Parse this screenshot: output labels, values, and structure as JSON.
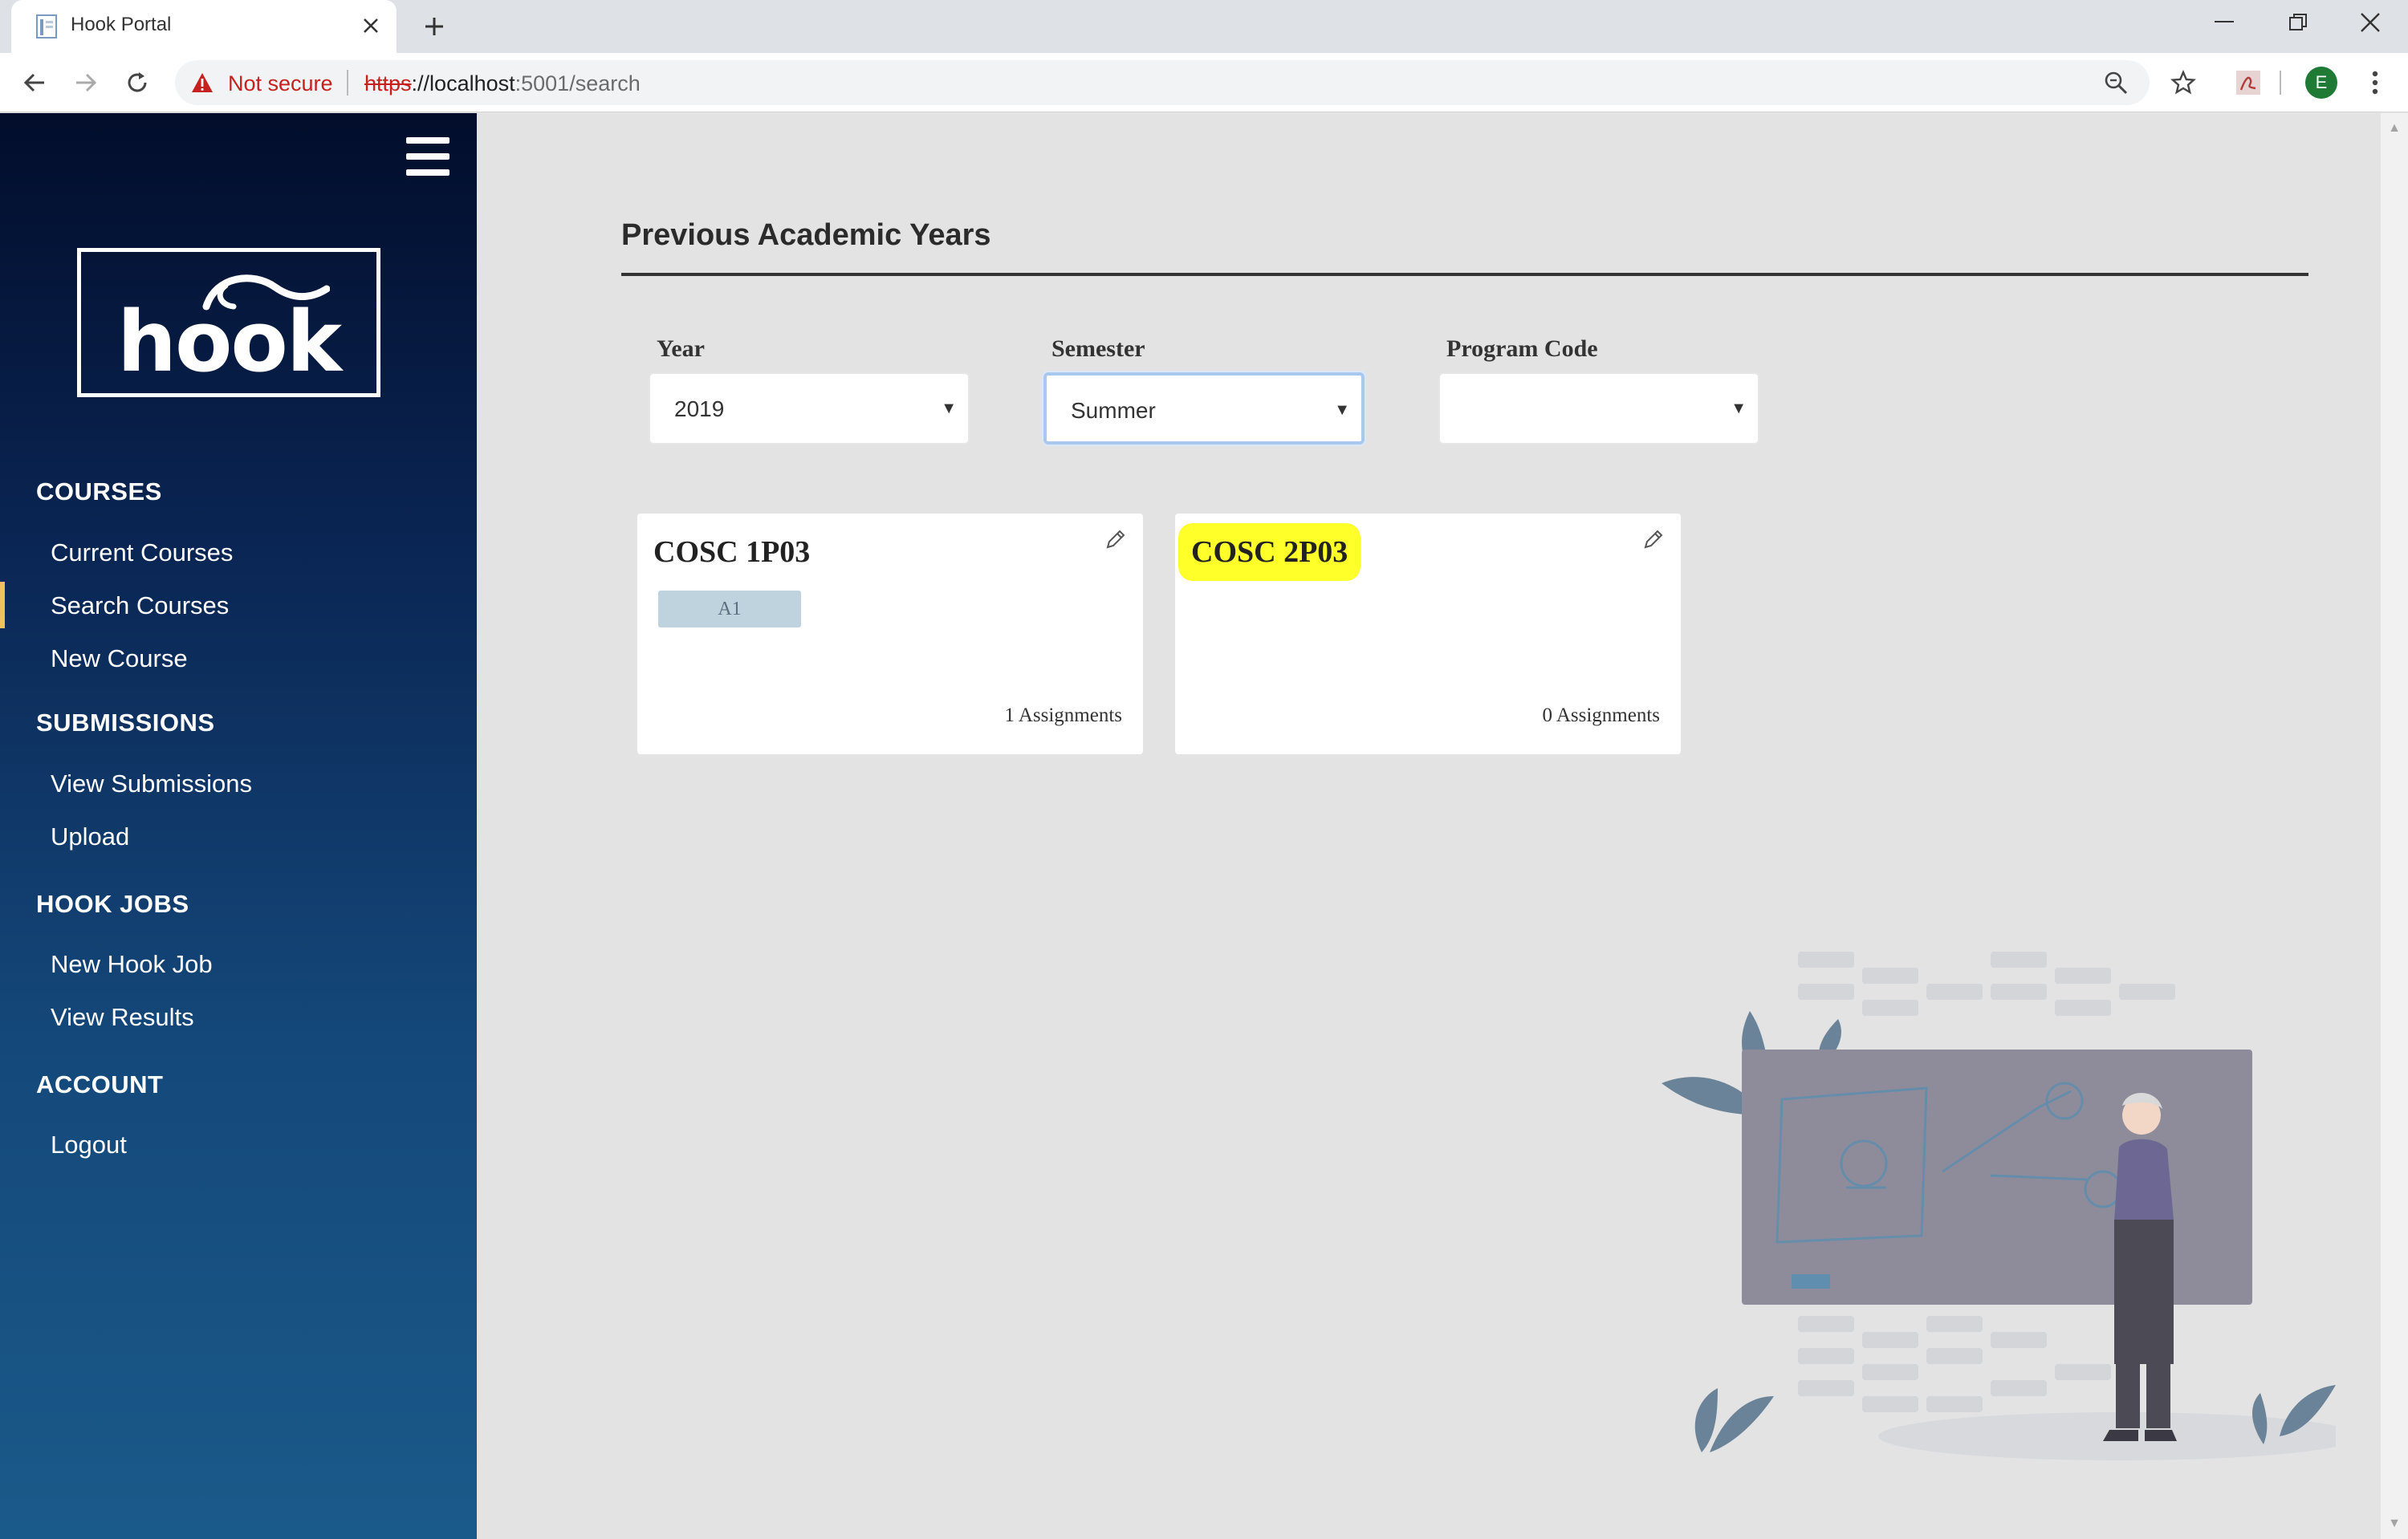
{
  "browser": {
    "tab_title": "Hook Portal",
    "not_secure_label": "Not secure",
    "url_scheme": "https",
    "url_host": "://localhost",
    "url_rest": ":5001/search",
    "profile_initial": "E"
  },
  "sidebar": {
    "sections": [
      {
        "heading": "COURSES",
        "items": [
          "Current Courses",
          "Search Courses",
          "New Course"
        ]
      },
      {
        "heading": "SUBMISSIONS",
        "items": [
          "View Submissions",
          "Upload"
        ]
      },
      {
        "heading": "HOOK JOBS",
        "items": [
          "New Hook Job",
          "View Results"
        ]
      },
      {
        "heading": "ACCOUNT",
        "items": [
          "Logout"
        ]
      }
    ],
    "active_item": "Search Courses",
    "logo_text": "hook"
  },
  "main": {
    "title": "Previous Academic Years",
    "filters": {
      "year_label": "Year",
      "year_value": "2019",
      "semester_label": "Semester",
      "semester_value": "Summer",
      "program_label": "Program Code",
      "program_value": ""
    },
    "cards": [
      {
        "code": "COSC 1P03",
        "tag": "A1",
        "assignments": "1 Assignments"
      },
      {
        "code": "COSC 2P03",
        "tag": "",
        "assignments": "0 Assignments"
      }
    ]
  },
  "colors": {
    "sidebar_top": "#020d2b",
    "sidebar_bottom": "#1a5a8a",
    "active_indicator": "#f0c060",
    "highlight": "#ffff2a",
    "page_bg": "#e3e3e3"
  }
}
